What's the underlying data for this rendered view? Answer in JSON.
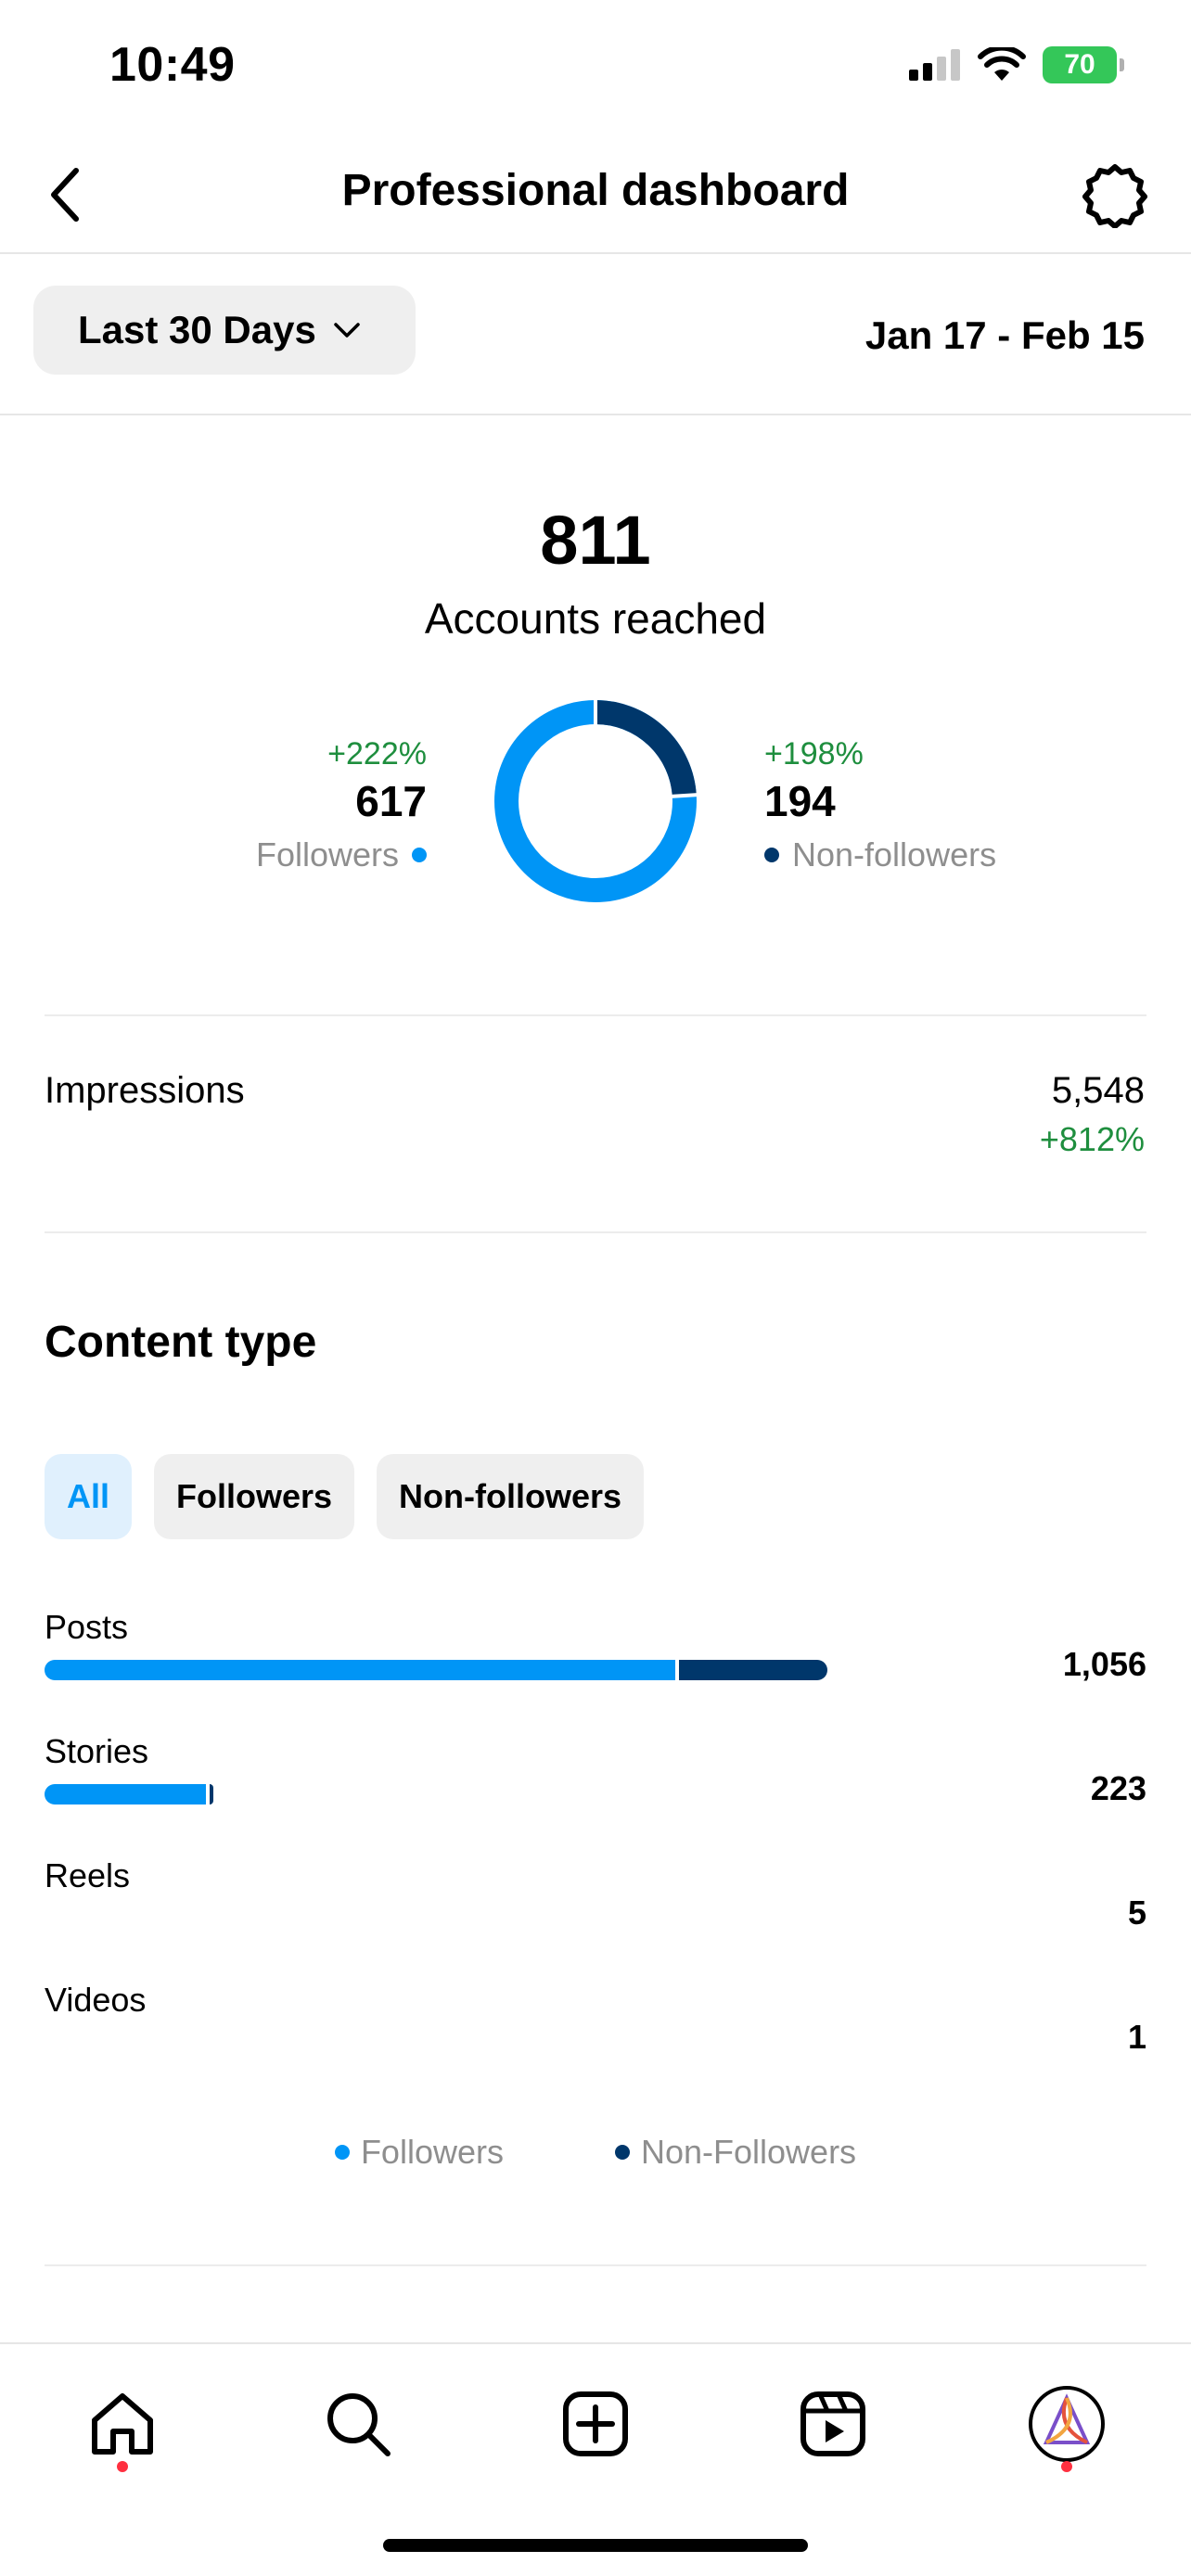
{
  "status": {
    "time": "10:49",
    "battery": "70"
  },
  "header": {
    "title": "Professional dashboard"
  },
  "filter": {
    "range_label": "Last 30 Days",
    "date_range": "Jan 17 - Feb 15"
  },
  "reach": {
    "total": "811",
    "label": "Accounts reached",
    "followers": {
      "pct": "+222%",
      "value": "617",
      "label": "Followers",
      "fraction": 0.76
    },
    "non_followers": {
      "pct": "+198%",
      "value": "194",
      "label": "Non-followers",
      "fraction": 0.24
    }
  },
  "impressions": {
    "label": "Impressions",
    "value": "5,548",
    "pct": "+812%"
  },
  "content_type": {
    "title": "Content type",
    "chips": [
      "All",
      "Followers",
      "Non-followers"
    ],
    "rows": [
      {
        "name": "Posts",
        "value": "1,056",
        "followers": 0.81,
        "non_followers": 0.19
      },
      {
        "name": "Stories",
        "value": "223",
        "followers": 0.98,
        "non_followers": 0.02
      },
      {
        "name": "Reels",
        "value": "5",
        "followers": 0,
        "non_followers": 0
      },
      {
        "name": "Videos",
        "value": "1",
        "followers": 0,
        "non_followers": 0
      }
    ],
    "legend": [
      "Followers",
      "Non-Followers"
    ]
  },
  "colors": {
    "followers": "#0095f6",
    "non_followers": "#00376b",
    "positive": "#1e8e3e",
    "active_chip_bg": "#e0f0fd"
  },
  "tabs": [
    "home-icon",
    "search-icon",
    "create-icon",
    "reels-icon",
    "profile-avatar"
  ]
}
